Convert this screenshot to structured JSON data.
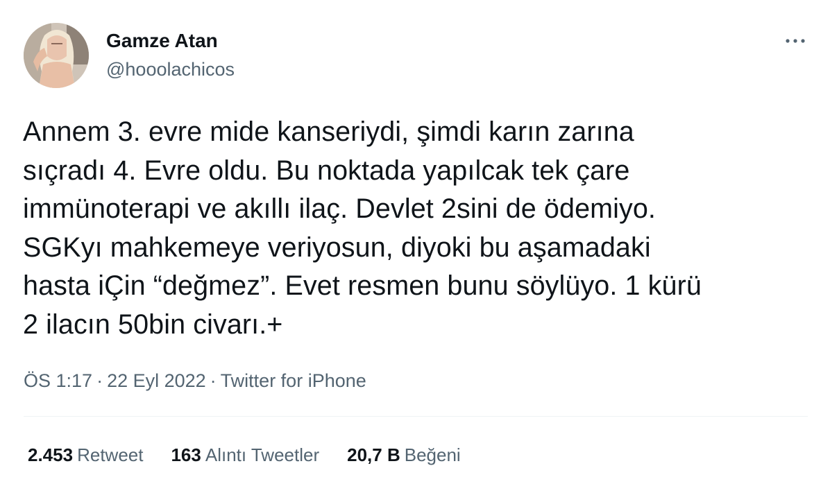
{
  "author": {
    "display_name": "Gamze Atan",
    "handle": "@hooolachicos"
  },
  "more_icon": "more-horizontal-icon",
  "tweet": {
    "text_lines": [
      "Annem 3. evre mide kanseriydi, şimdi karın zarına",
      "sıçradı 4. Evre oldu. Bu noktada yapılcak tek çare",
      "immünoterapi ve akıllı ilaç. Devlet 2sini de ödemiyo.",
      "SGKyı mahkemeye veriyosun, diyoki bu aşamadaki",
      "hasta iÇin “değmez”. Evet resmen bunu söylüyo. 1 kürü",
      "2 ilacın 50bin civarı.+"
    ]
  },
  "meta": {
    "time": "ÖS 1:17",
    "date": "22 Eyl 2022",
    "source": "Twitter for iPhone",
    "separator": "·"
  },
  "stats": {
    "retweets": {
      "count": "2.453",
      "label": "Retweet"
    },
    "quotes": {
      "count": "163",
      "label": "Alıntı Tweetler"
    },
    "likes": {
      "count": "20,7 B",
      "label": "Beğeni"
    }
  },
  "colors": {
    "primary_text": "#0f1419",
    "secondary_text": "#536471",
    "divider": "#eff3f4"
  }
}
